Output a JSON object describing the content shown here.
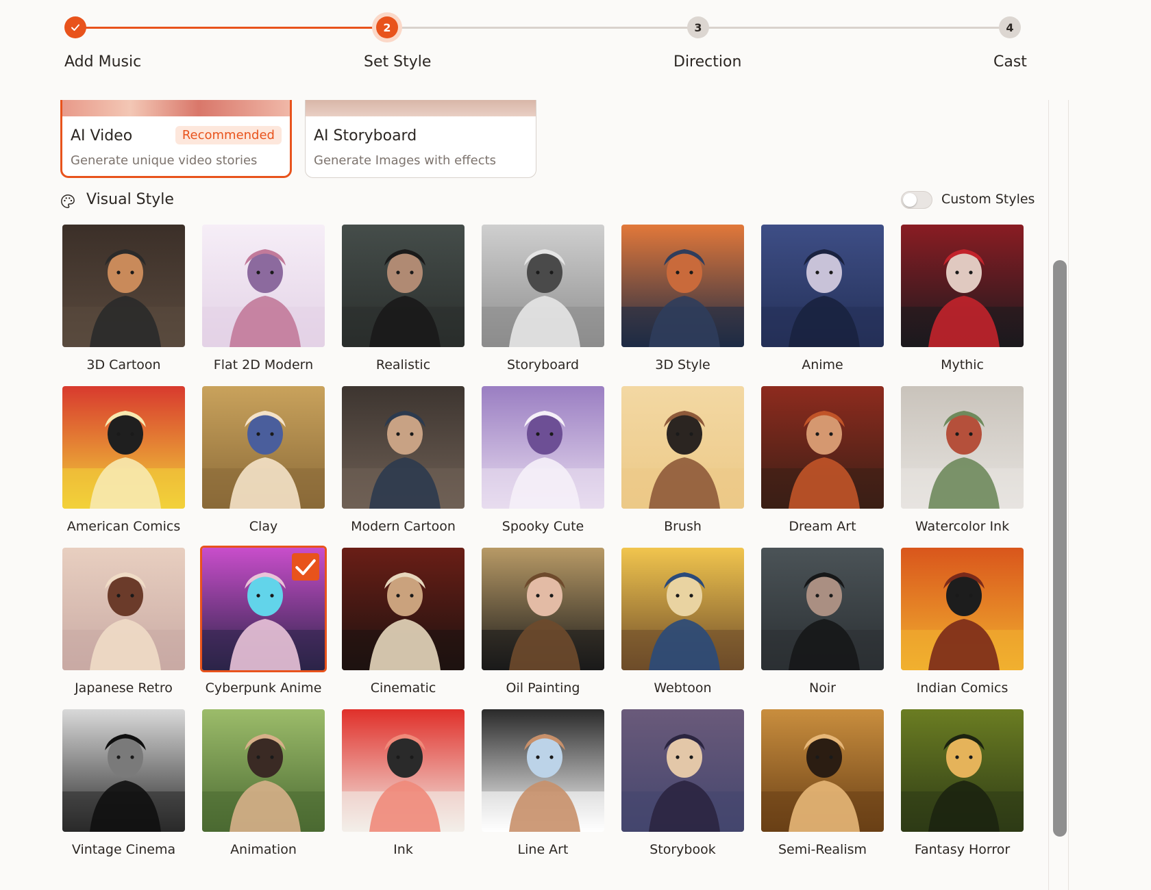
{
  "stepper": {
    "steps": [
      {
        "number": "",
        "label": "Add Music",
        "state": "complete"
      },
      {
        "number": "2",
        "label": "Set Style",
        "state": "current"
      },
      {
        "number": "3",
        "label": "Direction",
        "state": "pending"
      },
      {
        "number": "4",
        "label": "Cast",
        "state": "pending"
      }
    ]
  },
  "modes": [
    {
      "title": "AI Video",
      "badge": "Recommended",
      "description": "Generate unique video stories",
      "selected": true
    },
    {
      "title": "AI Storyboard",
      "badge": "",
      "description": "Generate Images with effects",
      "selected": false
    }
  ],
  "visual_style": {
    "title": "Visual Style",
    "icon": "palette-icon",
    "custom_styles_label": "Custom Styles",
    "custom_styles_enabled": false
  },
  "styles": [
    {
      "label": "3D Cartoon",
      "selected": false
    },
    {
      "label": "Flat 2D Modern",
      "selected": false
    },
    {
      "label": "Realistic",
      "selected": false
    },
    {
      "label": "Storyboard",
      "selected": false
    },
    {
      "label": "3D Style",
      "selected": false
    },
    {
      "label": "Anime",
      "selected": false
    },
    {
      "label": "Mythic",
      "selected": false
    },
    {
      "label": "American Comics",
      "selected": false
    },
    {
      "label": "Clay",
      "selected": false
    },
    {
      "label": "Modern Cartoon",
      "selected": false
    },
    {
      "label": "Spooky Cute",
      "selected": false
    },
    {
      "label": "Brush",
      "selected": false
    },
    {
      "label": "Dream Art",
      "selected": false
    },
    {
      "label": "Watercolor Ink",
      "selected": false
    },
    {
      "label": "Japanese Retro",
      "selected": false
    },
    {
      "label": "Cyberpunk Anime",
      "selected": true
    },
    {
      "label": "Cinematic",
      "selected": false
    },
    {
      "label": "Oil Painting",
      "selected": false
    },
    {
      "label": "Webtoon",
      "selected": false
    },
    {
      "label": "Noir",
      "selected": false
    },
    {
      "label": "Indian Comics",
      "selected": false
    },
    {
      "label": "Vintage Cinema",
      "selected": false
    },
    {
      "label": "Animation",
      "selected": false
    },
    {
      "label": "Ink",
      "selected": false
    },
    {
      "label": "Line Art",
      "selected": false
    },
    {
      "label": "Storybook",
      "selected": false
    },
    {
      "label": "Semi-Realism",
      "selected": false
    },
    {
      "label": "Fantasy Horror",
      "selected": false
    }
  ],
  "colors": {
    "accent": "#e8531c",
    "accent_soft": "#fde7dc",
    "pending_step": "#dcd6d1",
    "background": "#fbfaf8"
  }
}
